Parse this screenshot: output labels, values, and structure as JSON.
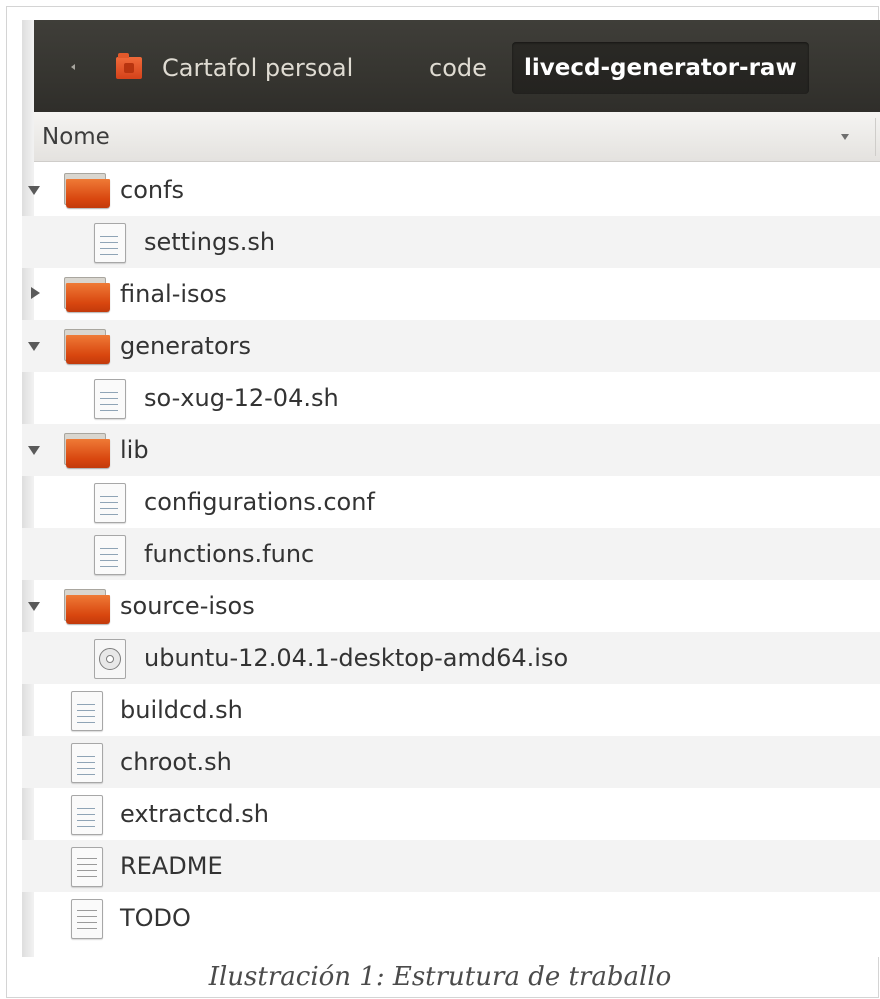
{
  "toolbar": {
    "breadcrumbs": [
      {
        "label": "Cartafol persoal"
      },
      {
        "label": "code"
      },
      {
        "label": "livecd-generator-raw"
      }
    ]
  },
  "header": {
    "column_name": "Nome"
  },
  "rows": [
    {
      "name": "confs",
      "type": "folder",
      "expanded": true,
      "level": 0
    },
    {
      "name": "settings.sh",
      "type": "script",
      "level": 1
    },
    {
      "name": "final-isos",
      "type": "folder",
      "expanded": false,
      "level": 0
    },
    {
      "name": "generators",
      "type": "folder",
      "expanded": true,
      "level": 0
    },
    {
      "name": "so-xug-12-04.sh",
      "type": "script",
      "level": 1
    },
    {
      "name": "lib",
      "type": "folder",
      "expanded": true,
      "level": 0
    },
    {
      "name": "configurations.conf",
      "type": "script",
      "level": 1
    },
    {
      "name": "functions.func",
      "type": "script",
      "level": 1
    },
    {
      "name": "source-isos",
      "type": "folder",
      "expanded": true,
      "level": 0
    },
    {
      "name": "ubuntu-12.04.1-desktop-amd64.iso",
      "type": "disc",
      "level": 1
    },
    {
      "name": "buildcd.sh",
      "type": "script",
      "level": 0
    },
    {
      "name": "chroot.sh",
      "type": "script",
      "level": 0
    },
    {
      "name": "extractcd.sh",
      "type": "script",
      "level": 0
    },
    {
      "name": "README",
      "type": "text",
      "level": 0
    },
    {
      "name": "TODO",
      "type": "text",
      "level": 0
    }
  ],
  "caption": "Ilustración 1: Estrutura de traballo",
  "colors": {
    "toolbar_bg": "#363530",
    "folder_orange": "#d8460f",
    "row_alt": "#f3f3f3"
  }
}
